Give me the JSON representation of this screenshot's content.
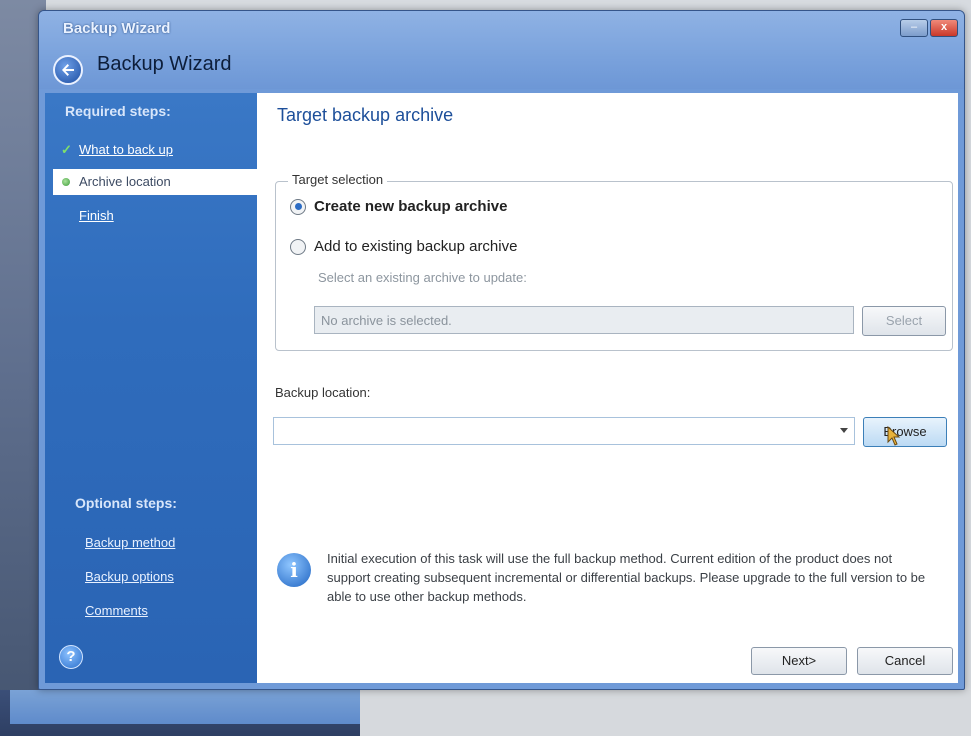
{
  "window": {
    "title": "Backup Wizard",
    "heading": "Backup Wizard",
    "minimize_glyph": "–",
    "close_glyph": "x"
  },
  "sidebar": {
    "required_heading": "Required steps:",
    "required_items": [
      {
        "label": "What to back up",
        "state": "completed"
      },
      {
        "label": "Archive location",
        "state": "current"
      },
      {
        "label": "Finish",
        "state": "pending"
      }
    ],
    "optional_heading": "Optional steps:",
    "optional_items": [
      {
        "label": "Backup method"
      },
      {
        "label": "Backup options"
      },
      {
        "label": "Comments"
      }
    ],
    "help_glyph": "?"
  },
  "main": {
    "title": "Target backup archive",
    "target_selection": {
      "legend": "Target selection",
      "option_new": "Create new backup archive",
      "option_existing": "Add to existing backup archive",
      "selected": "new",
      "existing_prompt": "Select an existing archive to update:",
      "archive_value": "No archive is selected.",
      "select_button": "Select"
    },
    "backup_location": {
      "label": "Backup location:",
      "value": "",
      "browse_button": "Browse"
    },
    "info": {
      "glyph": "i",
      "text": "Initial execution of this task will use the full backup method. Current edition of the product does not support creating subsequent incremental or differential backups. Please upgrade to the full version to be able to use other backup methods."
    },
    "buttons": {
      "next": "Next>",
      "cancel": "Cancel"
    }
  },
  "colors": {
    "sidebar": "#2f6cbc",
    "title_text": "#1d4f9a",
    "window_frame": "#6f9ad8"
  }
}
